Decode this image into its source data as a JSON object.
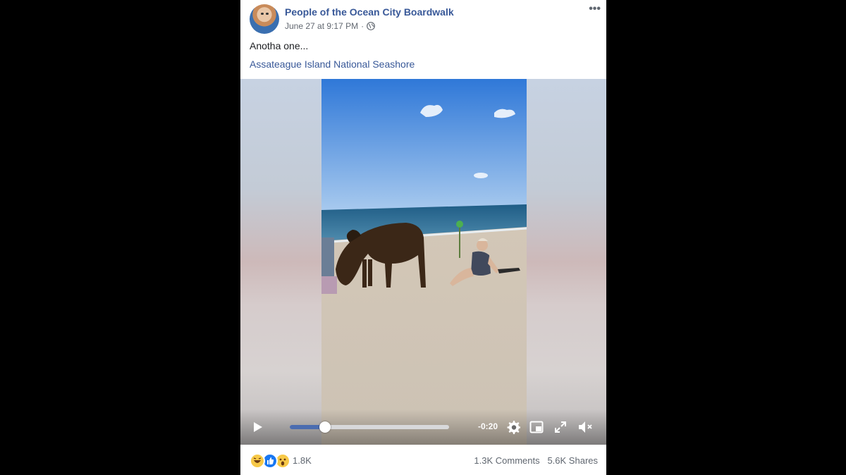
{
  "post": {
    "page_name": "People of the Ocean City Boardwalk",
    "timestamp": "June 27 at 9:17 PM",
    "separator": "·",
    "visibility_icon": "globe-icon",
    "more_label": "•••",
    "caption": "Anotha one...",
    "location": "Assateague Island National Seashore"
  },
  "video": {
    "time_remaining": "-0:20",
    "progress": 0.22,
    "controls": [
      "play-icon",
      "settings-icon",
      "pip-icon",
      "fullscreen-icon",
      "mute-icon"
    ]
  },
  "footer": {
    "reactions": [
      "haha",
      "like",
      "wow"
    ],
    "reaction_count": "1.8K",
    "comments": "1.3K Comments",
    "shares": "5.6K Shares"
  },
  "colors": {
    "link": "#385898",
    "accent": "#4267b2",
    "muted": "#606770"
  }
}
